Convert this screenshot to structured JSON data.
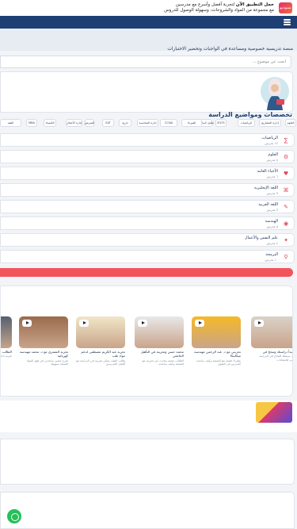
{
  "top_banner": {
    "app_logo_text": "ستوديو",
    "line1_bold": "حمل التطبيق الآن",
    "line1_rest": " لتجربة أفضل وأسرع مع مدرسين",
    "line2": "مع مجموعة من المواد والشروحات، وسهولة الوصول للدروس"
  },
  "hero": {
    "subtitle": "منصة تدريسية خصوصية ومساعدة في الواجبات وتحضير الاختبارات"
  },
  "search": {
    "placeholder": "ابحث عن موضوع ..."
  },
  "section_title": "تخصصات ومواضيع الدراسة",
  "chips": [
    "العلوم",
    "إدارة المشاريع",
    "الرياضيات",
    "IELTS",
    "تحليل البيانات",
    "الفيزياء",
    "CCNA",
    "إدارة المحاسبة",
    "تاريخ",
    "SAT",
    "التمريض",
    "إدارة الأعمال",
    "الكيمياء",
    "MBA",
    "الفقه"
  ],
  "subjects": [
    {
      "name": "الرياضيات",
      "sub": "١٢ مدرس"
    },
    {
      "name": "العلوم",
      "sub": "٨ مدرس"
    },
    {
      "name": "الأحياء العامة",
      "sub": "٦ مدرس"
    },
    {
      "name": "اللغة الإنجليزية",
      "sub": "٩ مدرس"
    },
    {
      "name": "اللغة العربية",
      "sub": "٧ مدرس"
    },
    {
      "name": "الهندسة",
      "sub": "٥ مدرس"
    },
    {
      "name": "علم النفس والأعمال",
      "sub": "٤ مدرس"
    },
    {
      "name": "البرمجة",
      "sub": "١٠ مدرس"
    }
  ],
  "videos": [
    {
      "title": "كيف تبدأ دراستك وتنجح في",
      "desc": "خطوات بسيطة للنجاح في الدراسة والتحضير للامتحانات"
    },
    {
      "title": "تجربتي مع د. عبد الرحمن مهندسة ميكانيكا",
      "desc": "يشارك قصته مع المنصة وكيف ساعده المدرس في التفوق"
    },
    {
      "title": "محمد حسن وتجربته في التأهيل الجامعي",
      "desc": "الطالب محمد يتحدث عن تجربته مع المنصة وكيف ساعدته"
    },
    {
      "title": "تجربة عبد الكريم مصطفى لدعم مواد طب",
      "desc": "طالب الطب يحكي تجربته في الدراسة مع أفضل المدرسين"
    },
    {
      "title": "تجربة الشمري مع د. محمد مهندسة كهربائية",
      "desc": "شرح متميز ساعدني في فهم المواد الصعبة بسهولة"
    },
    {
      "title": "الطالب يشارك تجربته مع",
      "desc": "تجربة ناجحة ومفيدة للغاية"
    }
  ],
  "colors": {
    "navbar": "#1d3f73",
    "accent_red": "#f2545b",
    "whatsapp": "#25c05a"
  }
}
